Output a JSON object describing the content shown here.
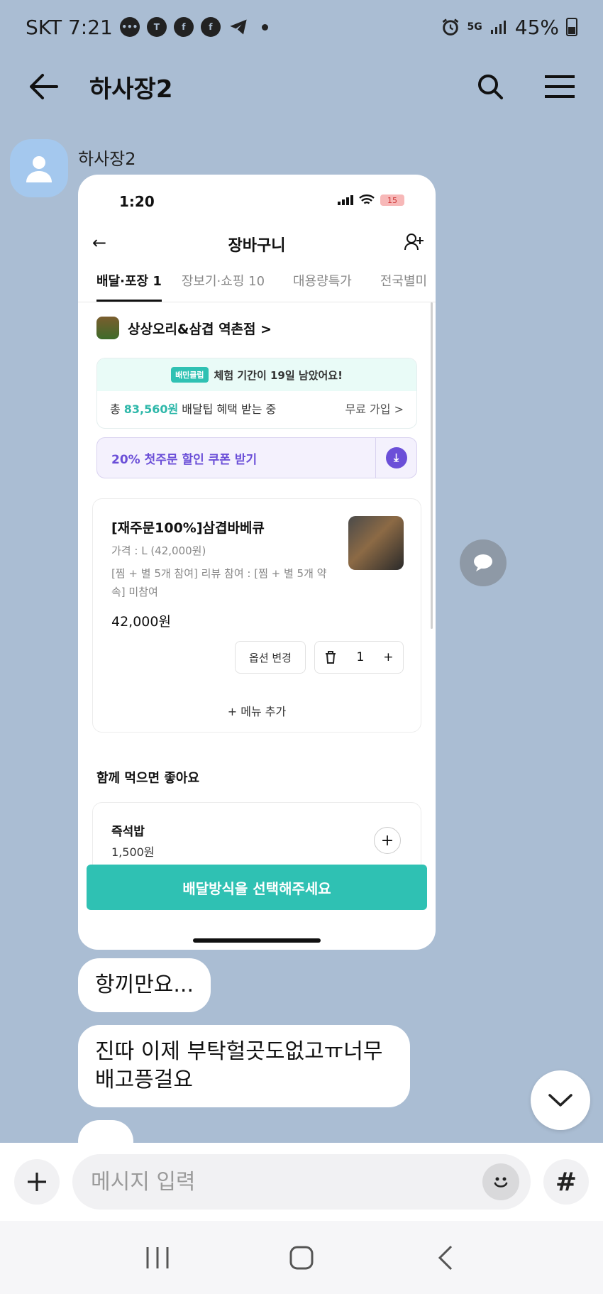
{
  "status_bar": {
    "carrier_time": "SKT 7:21",
    "network": "5G",
    "battery": "45%"
  },
  "header": {
    "title": "하사장2"
  },
  "message": {
    "sender": "하사장2",
    "image": {
      "time": "1:20",
      "battery": "15",
      "title": "장바구니",
      "tabs": [
        {
          "label": "배달·포장 1",
          "active": true
        },
        {
          "label": "장보기·쇼핑 10",
          "active": false
        },
        {
          "label": "대용량특가",
          "active": false
        },
        {
          "label": "전국별미",
          "active": false
        }
      ],
      "store": "상상오리&삼겹 역촌점 >",
      "promo_badge": "배민클럽",
      "promo_text": "체험 기간이 19일 남았어요!",
      "promo_prefix": "총",
      "promo_amount": "83,560원",
      "promo_suffix": "배달팁 혜택 받는 중",
      "promo_join": "무료 가입 >",
      "coupon": "20% 첫주문 할인 쿠폰 받기",
      "item_name": "[재주문100%]삼겹바베큐",
      "item_price_label": "가격 : L (42,000원)",
      "item_option": "[찜 + 별 5개 참여] 리뷰 참여 : [찜 + 별 5개 약속] 미참여",
      "item_price": "42,000원",
      "option_change": "옵션 변경",
      "quantity": "1",
      "add_menu": "+ 메뉴 추가",
      "together_title": "함께 먹으면 좋아요",
      "side_name": "즉석밥",
      "side_price": "1,500원",
      "select_button": "배달방식을 선택해주세요"
    },
    "bubbles": [
      {
        "text": "항끼만요..."
      },
      {
        "text": "진따 이제 부탁헐곳도없고ㅠ너무 배고픙걸요"
      }
    ]
  },
  "input": {
    "placeholder": "메시지 입력"
  },
  "colors": {
    "background": "#aabdd3",
    "accent": "#2fc1b3",
    "coupon": "#6b4fd8"
  }
}
